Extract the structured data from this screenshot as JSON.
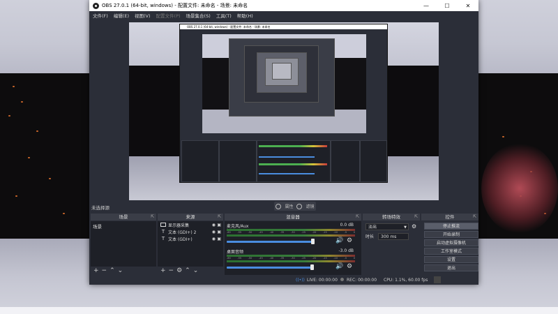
{
  "window": {
    "title": "OBS 27.0.1 (64-bit, windows) - 配置文件: 未命名 - 场景: 未命名",
    "controls": {
      "minimize": "—",
      "maximize": "☐",
      "close": "✕"
    }
  },
  "menu": [
    "文件(F)",
    "编辑(E)",
    "视图(V)",
    "配置文件(P)",
    "场景集合(S)",
    "工具(T)",
    "帮助(H)"
  ],
  "menu_disabled_index": 3,
  "nested_title": "OBS 27.0.1 (64-bit, windows) - 配置文件: 未命名 - 场景: 未命名",
  "source_bar": {
    "label": "未选择源",
    "properties": "属性",
    "filters": "滤镜"
  },
  "docks": {
    "scenes": {
      "title": "场景",
      "items": [
        "场景"
      ],
      "footer": [
        "+",
        "−",
        "⌃",
        "⌄"
      ]
    },
    "sources": {
      "title": "来源",
      "items": [
        {
          "icon": "monitor",
          "name": "显示器采集"
        },
        {
          "icon": "text",
          "name": "文本 (GDI+) 2"
        },
        {
          "icon": "text",
          "name": "文本 (GDI+)"
        }
      ],
      "footer": [
        "+",
        "−",
        "⚙",
        "⌃",
        "⌄"
      ]
    },
    "mixer": {
      "title": "混音器",
      "channels": [
        {
          "name": "麦克风/Aux",
          "db": "0.0 dB",
          "level": 0.82
        },
        {
          "name": "桌面音频",
          "db": "-3.0 dB",
          "level": 0.81
        }
      ],
      "ticks": [
        "-60",
        "-55",
        "-50",
        "-45",
        "-40",
        "-35",
        "-30",
        "-25",
        "-20",
        "-15",
        "-10",
        "-5",
        "0"
      ]
    },
    "transitions": {
      "title": "转场特效",
      "selected": "淡出",
      "duration_label": "时长",
      "duration_value": "300 ms"
    },
    "controls": {
      "title": "控件",
      "buttons": [
        "停止推流",
        "开始录制",
        "启动虚拟摄像机",
        "工作室模式",
        "设置",
        "退出"
      ]
    }
  },
  "status": {
    "live": "LIVE: 00:00:00",
    "rec": "REC: 00:00:00",
    "cpu": "CPU: 1.1%, 60.00 fps"
  },
  "colors": {
    "window_bg": "#2b2e38",
    "panel_bg": "#1e2027",
    "accent_blue": "#4a8de0",
    "meter_green": "#3c8f3f"
  }
}
